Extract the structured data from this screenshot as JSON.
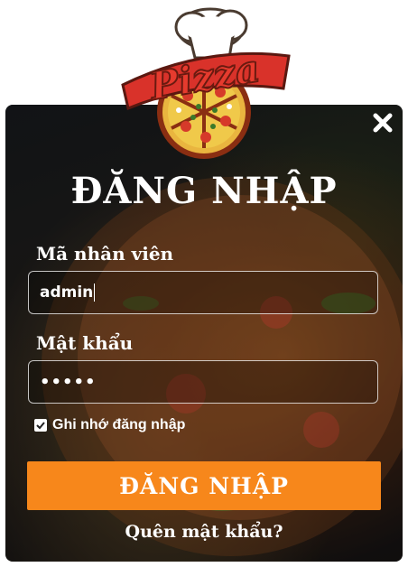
{
  "logo": {
    "text": "Pizza"
  },
  "form": {
    "title": "ĐĂNG NHẬP",
    "employee_id_label": "Mã nhân viên",
    "employee_id_value": "admin",
    "password_label": "Mật khẩu",
    "password_value": "•••••",
    "remember_label": "Ghi nhớ đăng nhập",
    "remember_checked": true,
    "submit_label": "ĐĂNG NHẬP",
    "forgot_label": "Quên mật khẩu?"
  },
  "colors": {
    "accent": "#f7871b",
    "logo_red": "#d9322a",
    "text": "#ffffff"
  },
  "icons": [
    "close-icon",
    "check-icon",
    "pizza-logo"
  ]
}
